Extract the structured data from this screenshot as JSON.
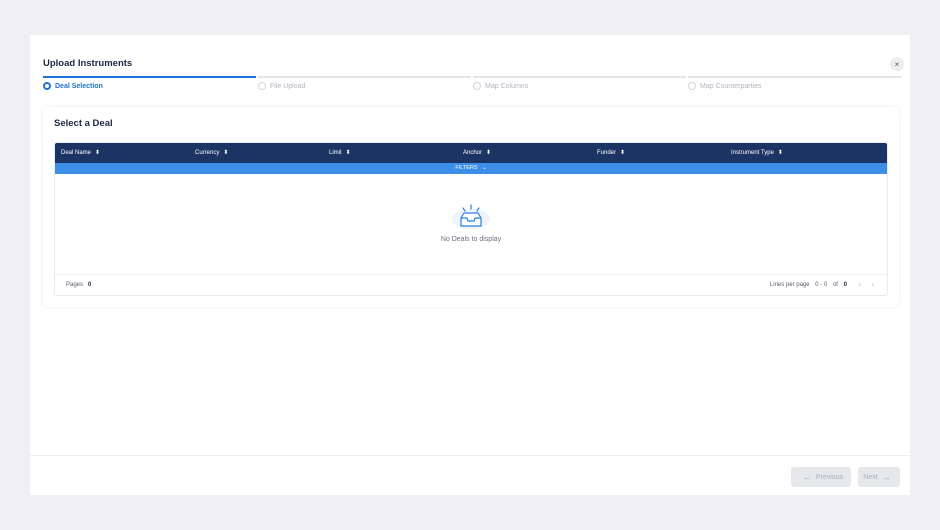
{
  "modal": {
    "title": "Upload Instruments",
    "close_icon": "×"
  },
  "steps": [
    {
      "label": "Deal Selection",
      "active": true
    },
    {
      "label": "File Upload",
      "active": false
    },
    {
      "label": "Map Columns",
      "active": false
    },
    {
      "label": "Map Counterparties",
      "active": false
    }
  ],
  "card": {
    "title": "Select a Deal"
  },
  "table": {
    "columns": [
      "Deal Name",
      "Currency",
      "Limit",
      "Anchor",
      "Funder",
      "Instrument Type"
    ],
    "sort_icon": "⬍",
    "filters_label": "FILTERS",
    "filters_chevron": "⌄",
    "empty_text": "No Deals to display",
    "footer": {
      "pages_label": "Pages",
      "pages_value": "0",
      "lines_label": "Lines per page",
      "range": "0 - 0",
      "of_label": "of",
      "total": "0",
      "prev_icon": "‹",
      "next_icon": "›"
    }
  },
  "buttons": {
    "previous": "Previous",
    "previous_icon": "←",
    "next": "Next",
    "next_icon": "→"
  },
  "colors": {
    "accent": "#1f73d6",
    "header": "#1c3464",
    "filters_bar": "#3d8ee6"
  }
}
